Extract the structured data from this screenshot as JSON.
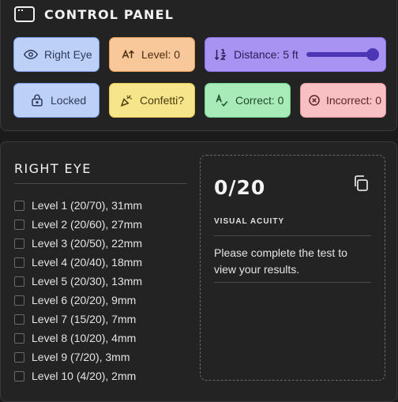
{
  "control_panel": {
    "title": "CONTROL PANEL",
    "buttons": {
      "right_eye": {
        "label": "Right Eye",
        "icon": "eye-icon"
      },
      "level": {
        "label": "Level: 0",
        "icon": "level-arrow-icon"
      },
      "distance": {
        "label": "Distance: 5 ft",
        "icon": "sort-numeric-icon",
        "slider_fraction": 1.0
      },
      "locked": {
        "label": "Locked",
        "icon": "lock-icon"
      },
      "confetti": {
        "label": "Confetti?",
        "icon": "party-popper-icon"
      },
      "correct": {
        "label": "Correct: 0",
        "icon": "check-text-icon"
      },
      "incorrect": {
        "label": "Incorrect: 0",
        "icon": "x-circle-icon"
      }
    },
    "colors": {
      "blue": "#bcd0f8",
      "orange": "#f8c79a",
      "purple": "#a893f2",
      "yellow": "#f7e58b",
      "green": "#a8eab8",
      "red": "#f8c0c3"
    }
  },
  "eye_section": {
    "title": "RIGHT EYE",
    "levels": [
      "Level 1 (20/70), 31mm",
      "Level 2 (20/60), 27mm",
      "Level 3 (20/50), 22mm",
      "Level 4 (20/40), 18mm",
      "Level 5 (20/30), 13mm",
      "Level 6 (20/20), 9mm",
      "Level 7 (15/20), 7mm",
      "Level 8 (10/20), 4mm",
      "Level 9 (7/20), 3mm",
      "Level 10 (4/20), 2mm"
    ]
  },
  "results": {
    "score": "0/20",
    "label": "VISUAL ACUITY",
    "message": "Please complete the test to view your results."
  }
}
